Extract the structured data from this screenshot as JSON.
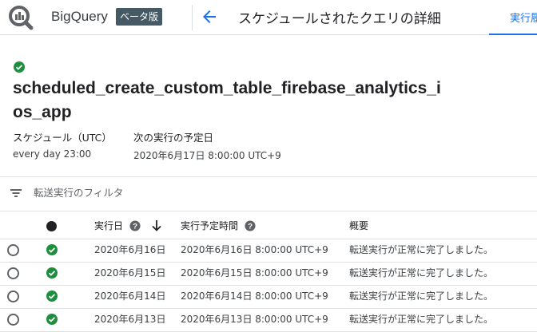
{
  "header": {
    "brand": "BigQuery",
    "beta_badge": "ベータ版",
    "page_title": "スケジュールされたクエリの詳細",
    "active_tab": "実行履歴",
    "logo_icon": "bigquery-logo",
    "back_icon": "arrow-back-icon"
  },
  "details": {
    "status": "success",
    "config_name": "scheduled_create_custom_table_firebase_analytics_ios_app",
    "schedule_label": "スケジュール（UTC）",
    "schedule_value": "every day 23:00",
    "next_run_label": "次の実行の予定日",
    "next_run_value": "2020年6月17日 8:00:00 UTC+9"
  },
  "filter": {
    "placeholder": "転送実行のフィルタ",
    "icon": "filter-list-icon"
  },
  "table": {
    "columns": {
      "run_date": "実行日",
      "scheduled_time": "実行予定時間",
      "summary": "概要"
    },
    "sort": "descending",
    "rows": [
      {
        "run_date": "2020年6月16日",
        "scheduled_time": "2020年6月16日 8:00:00 UTC+9",
        "summary": "転送実行が正常に完了しました。",
        "status": "success"
      },
      {
        "run_date": "2020年6月15日",
        "scheduled_time": "2020年6月15日 8:00:00 UTC+9",
        "summary": "転送実行が正常に完了しました。",
        "status": "success"
      },
      {
        "run_date": "2020年6月14日",
        "scheduled_time": "2020年6月14日 8:00:00 UTC+9",
        "summary": "転送実行が正常に完了しました。",
        "status": "success"
      },
      {
        "run_date": "2020年6月13日",
        "scheduled_time": "2020年6月13日 8:00:00 UTC+9",
        "summary": "転送実行が正常に完了しました。",
        "status": "success"
      }
    ]
  },
  "colors": {
    "accent": "#1a73e8",
    "success": "#1e8e3e",
    "beta_badge_bg": "#455a64"
  }
}
